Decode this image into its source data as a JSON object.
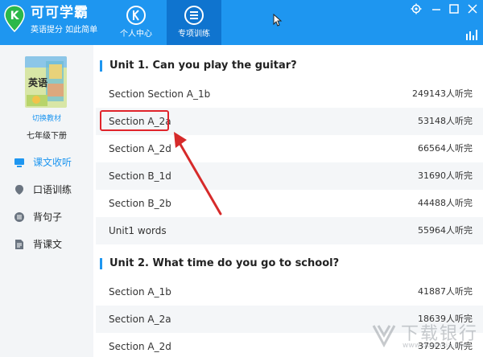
{
  "app": {
    "name": "可可学霸",
    "slogan": "英语提分 如此简单"
  },
  "nav": [
    {
      "label": "个人中心",
      "active": false
    },
    {
      "label": "专项训练",
      "active": true
    }
  ],
  "sidebar": {
    "book_cover_text": "英语",
    "switch_label": "切换教材",
    "grade": "七年级下册",
    "items": [
      {
        "label": "课文收听",
        "icon": "screen-icon",
        "active": true
      },
      {
        "label": "口语训练",
        "icon": "microphone-icon",
        "active": false
      },
      {
        "label": "背句子",
        "icon": "list-icon",
        "active": false
      },
      {
        "label": "背课文",
        "icon": "document-icon",
        "active": false
      }
    ]
  },
  "units": [
    {
      "title": "Unit 1. Can you play the guitar?",
      "sections": [
        {
          "name": "Section Section A_1b",
          "count": "249143人听完"
        },
        {
          "name": "Section A_2a",
          "count": "53148人听完"
        },
        {
          "name": "Section A_2d",
          "count": "66564人听完"
        },
        {
          "name": "Section B_1d",
          "count": "31690人听完"
        },
        {
          "name": "Section B_2b",
          "count": "44488人听完"
        },
        {
          "name": "Unit1 words",
          "count": "55964人听完"
        }
      ]
    },
    {
      "title": "Unit 2. What time do you go to school?",
      "sections": [
        {
          "name": "Section A_1b",
          "count": "41887人听完"
        },
        {
          "name": "Section A_2a",
          "count": "18639人听完"
        },
        {
          "name": "Section A_2d",
          "count": "37923人听完"
        }
      ]
    }
  ],
  "annotation": {
    "highlight_color": "#e0242b"
  },
  "watermark": {
    "text": "下载银行",
    "url": "www.downxia.com"
  },
  "colors": {
    "brand": "#1e96f0",
    "active_tab": "#0f74cf"
  }
}
